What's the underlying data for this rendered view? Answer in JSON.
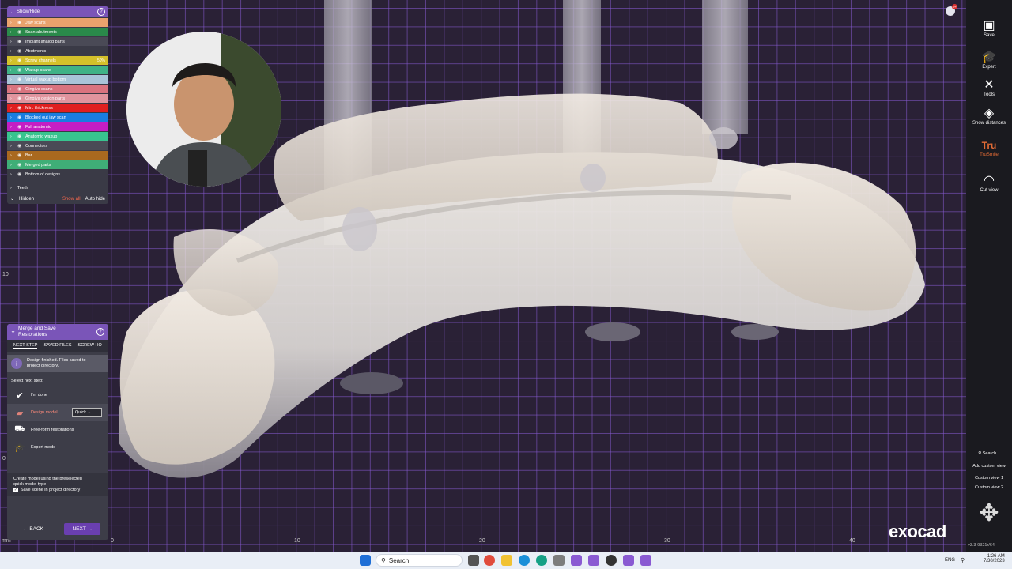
{
  "show_hide": {
    "title": "Show/Hide",
    "items": [
      {
        "label": "Jaw scans",
        "color": "#e9a26d"
      },
      {
        "label": "Scan abutments",
        "color": "#2a8a4a"
      },
      {
        "label": "Implant analog parts",
        "color": "#4a4a56"
      },
      {
        "label": "Abutments",
        "color": "#3a3a46"
      },
      {
        "label": "Screw channels",
        "color": "#d4c12a",
        "value": "50%"
      },
      {
        "label": "Waxup scans",
        "color": "#3fb286"
      },
      {
        "label": "Virtual waxup bottom",
        "color": "#a9c4d8"
      },
      {
        "label": "Gingiva scans",
        "color": "#d9737f"
      },
      {
        "label": "Gingiva design parts",
        "color": "#e0949e"
      },
      {
        "label": "Min. thickness",
        "color": "#e01f1f"
      },
      {
        "label": "Blocked out jaw scan",
        "color": "#1a7de0"
      },
      {
        "label": "Full anatomic",
        "color": "#c41ec4"
      },
      {
        "label": "Anatomic waxup",
        "color": "#38c48f"
      },
      {
        "label": "Connectors",
        "color": "#4a4a56"
      },
      {
        "label": "Bar",
        "color": "#a9691f"
      },
      {
        "label": "Merged parts",
        "color": "#3fae77"
      },
      {
        "label": "Bottom of designs",
        "color": "#3a3a46"
      },
      {
        "label": "Teeth",
        "color": "#3a3a46"
      }
    ],
    "footer": {
      "hidden": "Hidden",
      "show_all": "Show all",
      "auto_hide": "Auto hide"
    }
  },
  "merge_panel": {
    "title_line1": "Merge and Save",
    "title_line2": "Restorations",
    "tabs": [
      "NEXT STEP",
      "SAVED FILES",
      "SCREW HO"
    ],
    "info_line1": "Design finished. Files saved to",
    "info_line2": "project directory.",
    "select_label": "Select next step:",
    "steps": [
      "I'm done",
      "Design model",
      "Free-form restorations",
      "Expert mode"
    ],
    "model_option": "Quick",
    "note_line1": "Create model using the preselected",
    "note_line2": "quick model type",
    "checkbox_label": "Save scene in project directory",
    "back": "BACK",
    "next": "NEXT"
  },
  "sidebar": {
    "buttons": [
      {
        "label": "Save",
        "icon": "save-icon"
      },
      {
        "label": "Expert",
        "icon": "expert-hat-icon"
      },
      {
        "label": "Tools",
        "icon": "tools-icon"
      },
      {
        "label": "Show distances",
        "icon": "distances-icon"
      },
      {
        "label": "TruSmile",
        "icon": "trusmile-icon"
      },
      {
        "label": "Cut view",
        "icon": "cut-view-icon"
      }
    ],
    "search": "Search...",
    "add_view": "Add custom view",
    "view1": "Custom view 1",
    "view2": "Custom view 2"
  },
  "rulers": {
    "x_ticks": [
      "0",
      "10",
      "20",
      "30",
      "40"
    ],
    "y_ticks": [
      "10",
      "0"
    ],
    "unit": "mm"
  },
  "brand": "exocad",
  "version": "v3.3-9321r/64",
  "taskbar": {
    "search": "Search",
    "lang": "ENG",
    "time": "1:26 AM",
    "date": "7/30/2023"
  },
  "notification_count": "9+",
  "colors": {
    "accent": "#7a55b8",
    "grid": "#8a5ad2",
    "background": "#2a2136"
  }
}
